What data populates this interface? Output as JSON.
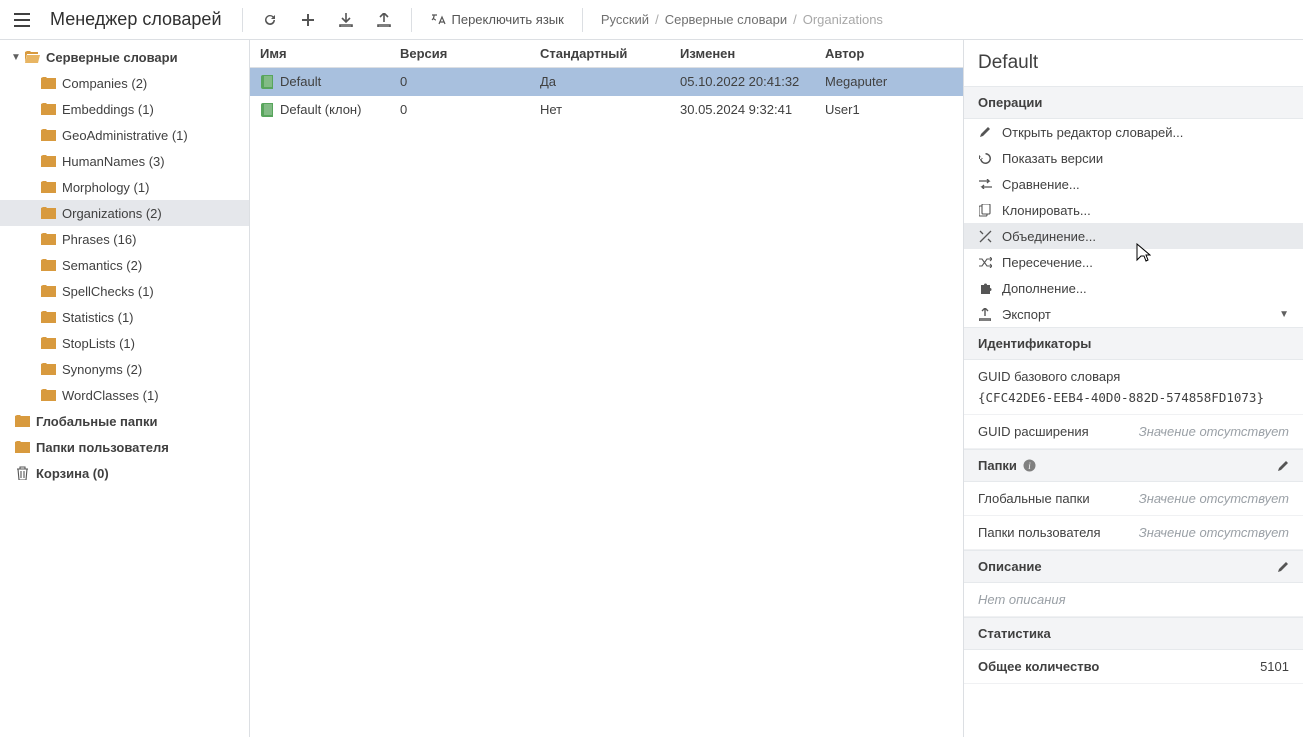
{
  "header": {
    "app_title": "Менеджер словарей",
    "switch_lang_label": "Переключить язык",
    "breadcrumb_root": "Русский",
    "breadcrumb_mid": "Серверные словари",
    "breadcrumb_cur": "Organizations"
  },
  "tree": {
    "root": "Серверные словари",
    "dicts": [
      "Companies (2)",
      "Embeddings (1)",
      "GeoAdministrative (1)",
      "HumanNames (3)",
      "Morphology (1)",
      "Organizations (2)",
      "Phrases (16)",
      "Semantics (2)",
      "SpellChecks (1)",
      "Statistics (1)",
      "StopLists (1)",
      "Synonyms (2)",
      "WordClasses (1)"
    ],
    "global_folders": "Глобальные папки",
    "user_folders": "Папки пользователя",
    "trash": "Корзина (0)"
  },
  "grid": {
    "cols": {
      "name": "Имя",
      "version": "Версия",
      "std": "Стандартный",
      "modified": "Изменен",
      "author": "Автор"
    },
    "rows": [
      {
        "name": "Default",
        "version": "0",
        "std": "Да",
        "modified": "05.10.2022 20:41:32",
        "author": "Megaputer"
      },
      {
        "name": "Default (клон)",
        "version": "0",
        "std": "Нет",
        "modified": "30.05.2024 9:32:41",
        "author": "User1"
      }
    ]
  },
  "panel": {
    "title": "Default",
    "operations_hdr": "Операции",
    "ops": {
      "open_editor": "Открыть редактор словарей...",
      "versions": "Показать версии",
      "compare": "Сравнение...",
      "clone": "Клонировать...",
      "union": "Объединение...",
      "intersect": "Пересечение...",
      "complement": "Дополнение...",
      "export": "Экспорт"
    },
    "ids_hdr": "Идентификаторы",
    "guid_base_label": "GUID базового словаря",
    "guid_base_value": "{CFC42DE6-EEB4-40D0-882D-574858FD1073}",
    "guid_ext_label": "GUID расширения",
    "empty_value": "Значение отсутствует",
    "folders_hdr": "Папки",
    "global_folders_label": "Глобальные папки",
    "user_folders_label": "Папки пользователя",
    "descr_hdr": "Описание",
    "no_descr": "Нет описания",
    "stats_hdr": "Статистика",
    "total_label": "Общее количество",
    "total_value": "5101"
  }
}
